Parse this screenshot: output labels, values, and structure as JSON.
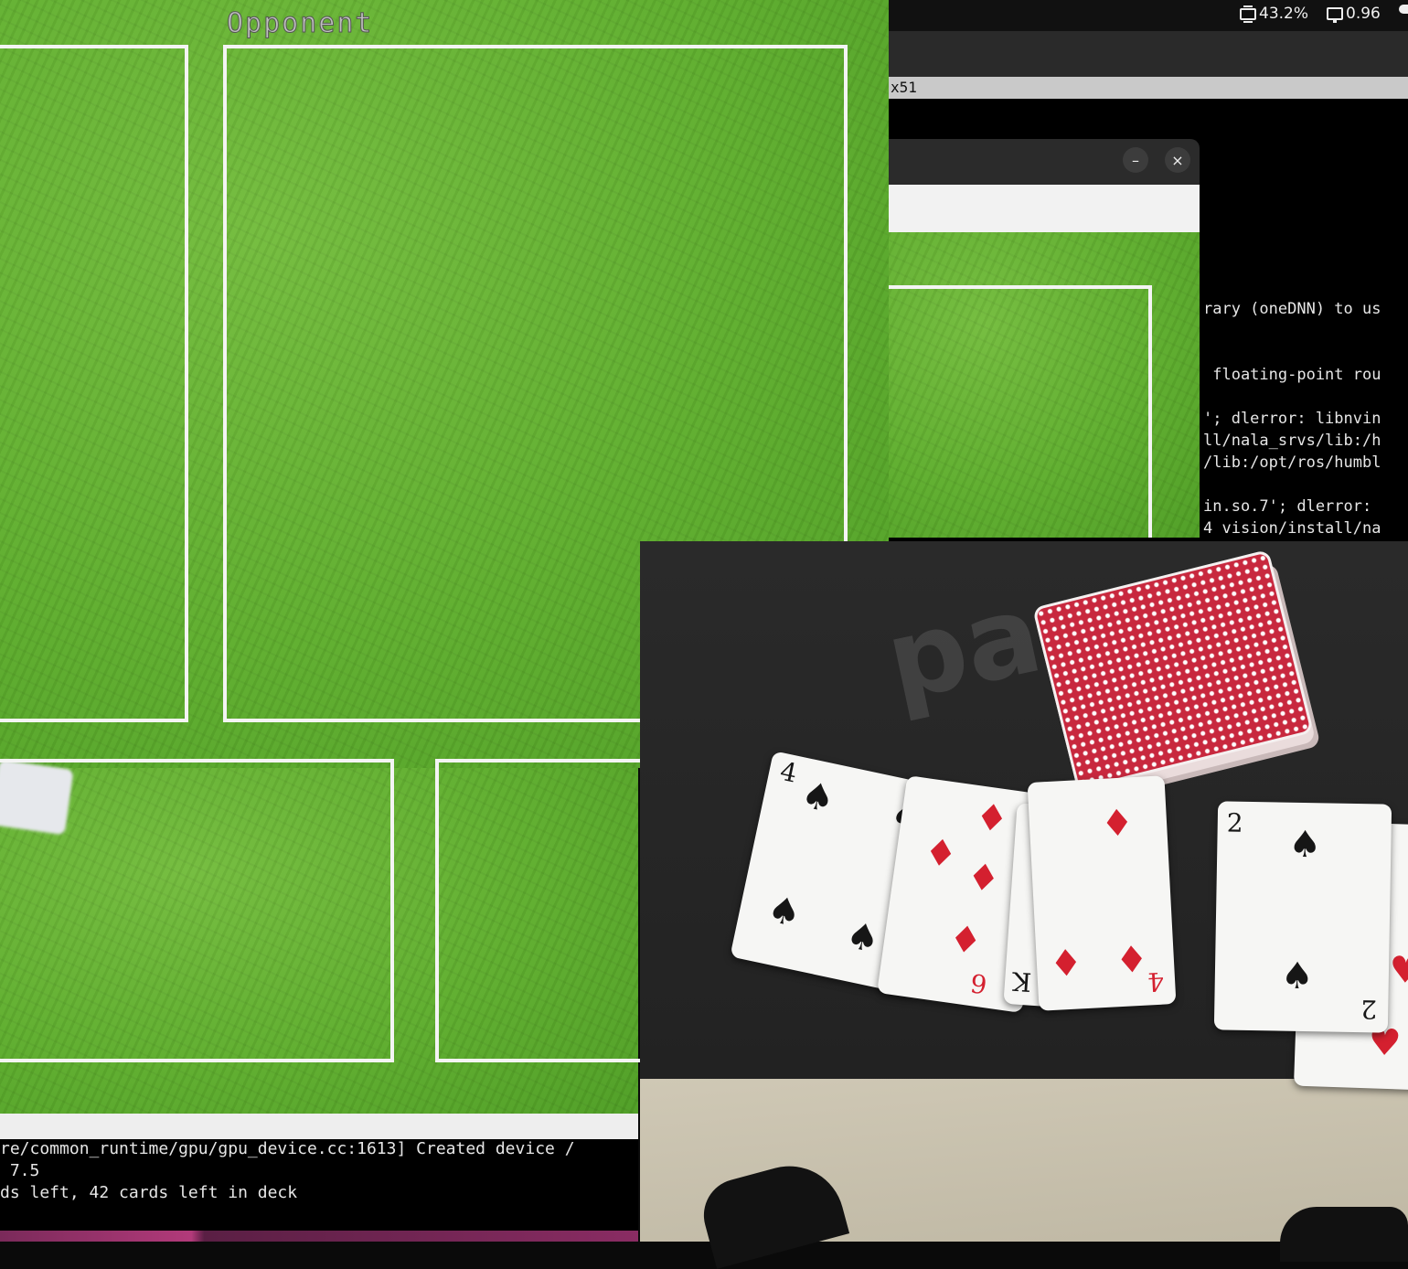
{
  "status_bar": {
    "cpu_text": "43.2%",
    "load_text": "0.96",
    "icons": [
      "cpu-chip-icon",
      "monitor-icon",
      "cloud-icon"
    ]
  },
  "terminal_back": {
    "title_fragment": "x51",
    "lines": [
      "rary (oneDNN) to us",
      " floating-point rou",
      "'; dlerror: libnvin",
      "ll/nala_srvs/lib:/h",
      "/lib:/opt/ros/humbl",
      "in.so.7'; dlerror: ",
      "4 vision/install/na"
    ]
  },
  "cv_window": {
    "minimize_glyph": "–",
    "close_glyph": "×"
  },
  "camera_view": {
    "zone_label": "Opponent"
  },
  "terminal_front": {
    "lines": [
      "re/common_runtime/gpu/gpu_device.cc:1613] Created device /",
      " 7.5",
      "ds left, 42 cards left in deck"
    ]
  },
  "photo": {
    "logo_text": "pac",
    "cards": [
      {
        "rank": "4",
        "suit": "♠"
      },
      {
        "rank": "6",
        "suit": "♦"
      },
      {
        "rank": "K",
        "suit": "♣"
      },
      {
        "rank": "4",
        "suit": "♦"
      },
      {
        "rank": "2",
        "suit": "♠"
      }
    ]
  },
  "colors": {
    "felt": "#62b030",
    "zone_border": "#f4f4f4",
    "terminal_bg": "#000000",
    "card_back": "#c8283e",
    "suit_red": "#d4202f"
  }
}
